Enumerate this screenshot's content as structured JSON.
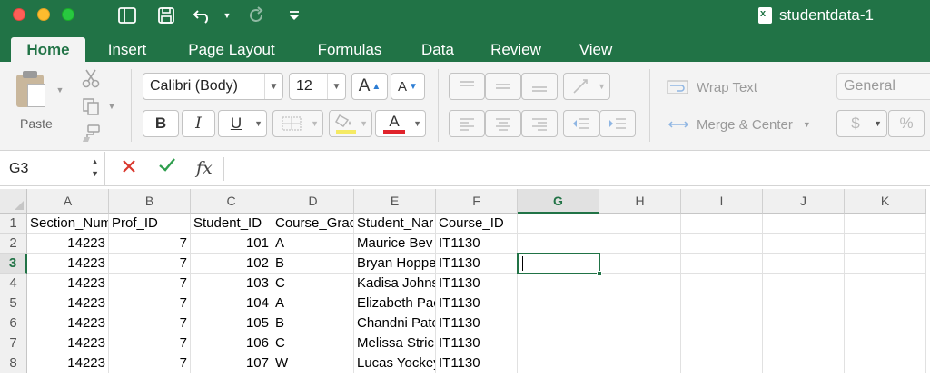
{
  "window": {
    "title": "studentdata-1"
  },
  "tabs": [
    "Home",
    "Insert",
    "Page Layout",
    "Formulas",
    "Data",
    "Review",
    "View"
  ],
  "ribbon": {
    "paste_label": "Paste",
    "font_name": "Calibri (Body)",
    "font_size": "12",
    "grow_font_label": "A",
    "shrink_font_label": "A",
    "bold_label": "B",
    "italic_label": "I",
    "underline_label": "U",
    "font_color_label": "A",
    "wrap_text_label": "Wrap Text",
    "merge_center_label": "Merge & Center",
    "number_format": "General",
    "currency_label": "$",
    "percent_label": "%",
    "fill_color": "#f5ea64",
    "font_color": "#e0232b"
  },
  "formula_bar": {
    "name_box": "G3",
    "fx_label": "fx",
    "value": ""
  },
  "sheet": {
    "columns": [
      "A",
      "B",
      "C",
      "D",
      "E",
      "F",
      "G",
      "H",
      "I",
      "J",
      "K"
    ],
    "selected_column": "G",
    "selected_row": "3",
    "rows": [
      {
        "num": "1",
        "cells": [
          "Section_Num",
          "Prof_ID",
          "Student_ID",
          "Course_Grad",
          "Student_Nar",
          "Course_ID",
          "",
          "",
          "",
          "",
          ""
        ]
      },
      {
        "num": "2",
        "cells": [
          "14223",
          "7",
          "101",
          "A",
          "Maurice Bev",
          "IT1130",
          "",
          "",
          "",
          "",
          ""
        ]
      },
      {
        "num": "3",
        "cells": [
          "14223",
          "7",
          "102",
          "B",
          "Bryan Hoppe",
          "IT1130",
          "",
          "",
          "",
          "",
          ""
        ]
      },
      {
        "num": "4",
        "cells": [
          "14223",
          "7",
          "103",
          "C",
          "Kadisa Johns",
          "IT1130",
          "",
          "",
          "",
          "",
          ""
        ]
      },
      {
        "num": "5",
        "cells": [
          "14223",
          "7",
          "104",
          "A",
          "Elizabeth Pac",
          "IT1130",
          "",
          "",
          "",
          "",
          ""
        ]
      },
      {
        "num": "6",
        "cells": [
          "14223",
          "7",
          "105",
          "B",
          "Chandni Pate",
          "IT1130",
          "",
          "",
          "",
          "",
          ""
        ]
      },
      {
        "num": "7",
        "cells": [
          "14223",
          "7",
          "106",
          "C",
          "Melissa Stric",
          "IT1130",
          "",
          "",
          "",
          "",
          ""
        ]
      },
      {
        "num": "8",
        "cells": [
          "14223",
          "7",
          "107",
          "W",
          "Lucas Yockey",
          "IT1130",
          "",
          "",
          "",
          "",
          ""
        ]
      }
    ],
    "numeric_columns": [
      0,
      1,
      2
    ]
  },
  "colors": {
    "accent": "#217346"
  }
}
